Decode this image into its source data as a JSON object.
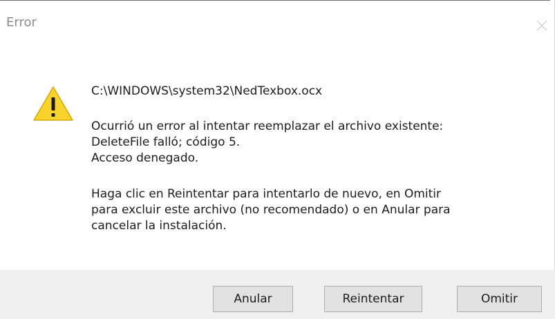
{
  "window": {
    "title": "Error",
    "close_icon": "close-icon"
  },
  "message": {
    "icon": "warning-icon",
    "lines": [
      "C:\\WINDOWS\\system32\\NedTexbox.ocx",
      "Ocurrió un error al intentar reemplazar el archivo existente:",
      "DeleteFile falló; código 5.",
      "Acceso denegado.",
      "Haga clic en Reintentar para intentarlo de nuevo, en Omitir",
      "para excluir este archivo (no recomendado) o en Anular para",
      "cancelar la instalación."
    ]
  },
  "buttons": {
    "cancel_label": "Anular",
    "retry_label": "Reintentar",
    "ignore_label": "Omitir"
  }
}
